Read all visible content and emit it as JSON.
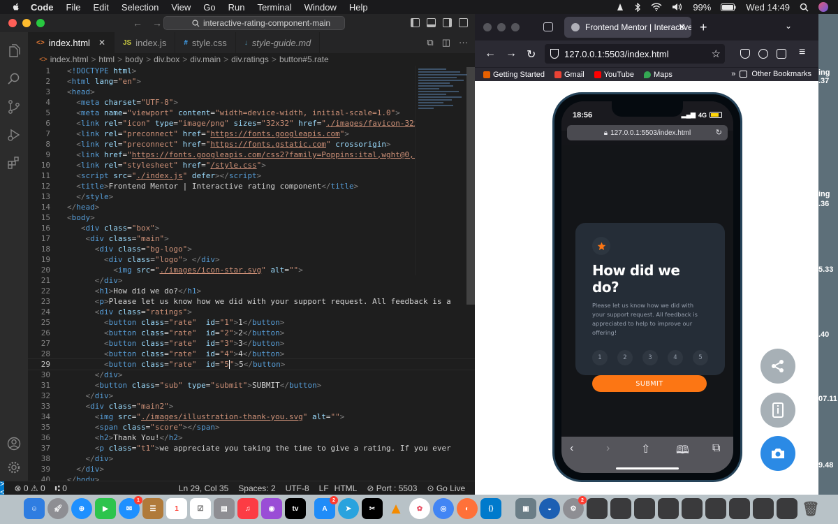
{
  "menubar": {
    "app": "Code",
    "items": [
      "File",
      "Edit",
      "Selection",
      "View",
      "Go",
      "Run",
      "Terminal",
      "Window",
      "Help"
    ],
    "battery": "99%",
    "clock": "Wed 14:49"
  },
  "vscode": {
    "search": "interactive-rating-component-main",
    "tabs": [
      {
        "icon": "<>",
        "label": "index.html"
      },
      {
        "icon": "JS",
        "label": "index.js"
      },
      {
        "icon": "#",
        "label": "style.css"
      },
      {
        "icon": "↓",
        "label": "style-guide.md"
      }
    ],
    "breadcrumb": [
      "index.html",
      "html",
      "body",
      "div.box",
      "div.main",
      "div.ratings",
      "button#5.rate"
    ],
    "status": {
      "errors": "0",
      "warnings": "0",
      "ports": "0",
      "position": "Ln 29, Col 35",
      "spaces": "Spaces: 2",
      "encoding": "UTF-8",
      "eol": "LF",
      "language": "HTML",
      "port": "Port : 5503",
      "golive": "Go Live"
    }
  },
  "browser": {
    "tab_title": "Frontend Mentor | Interactive ra",
    "url": "127.0.0.1:5503/index.html",
    "bookmarks": [
      "Getting Started",
      "Gmail",
      "YouTube",
      "Maps"
    ],
    "other_bookmarks": "Other Bookmarks"
  },
  "phone": {
    "time": "18:56",
    "network": "4G",
    "url": "127.0.0.1:5503/index.html",
    "card": {
      "title": "How did we do?",
      "description": "Please let us know how we did with your support request. All feedback is appreciated to help to improve our offering!",
      "ratings": [
        "1",
        "2",
        "3",
        "4",
        "5"
      ],
      "submit": "SUBMIT"
    }
  },
  "right_strip": [
    "ing",
    ".37",
    "ing",
    ".36",
    "5.33",
    ".40",
    "07.11",
    "9.48"
  ],
  "colors": {
    "orange": "#fc7614",
    "card_bg": "#252d37",
    "vscode_bg": "#1e1e1e",
    "accent_blue": "#007acc"
  }
}
